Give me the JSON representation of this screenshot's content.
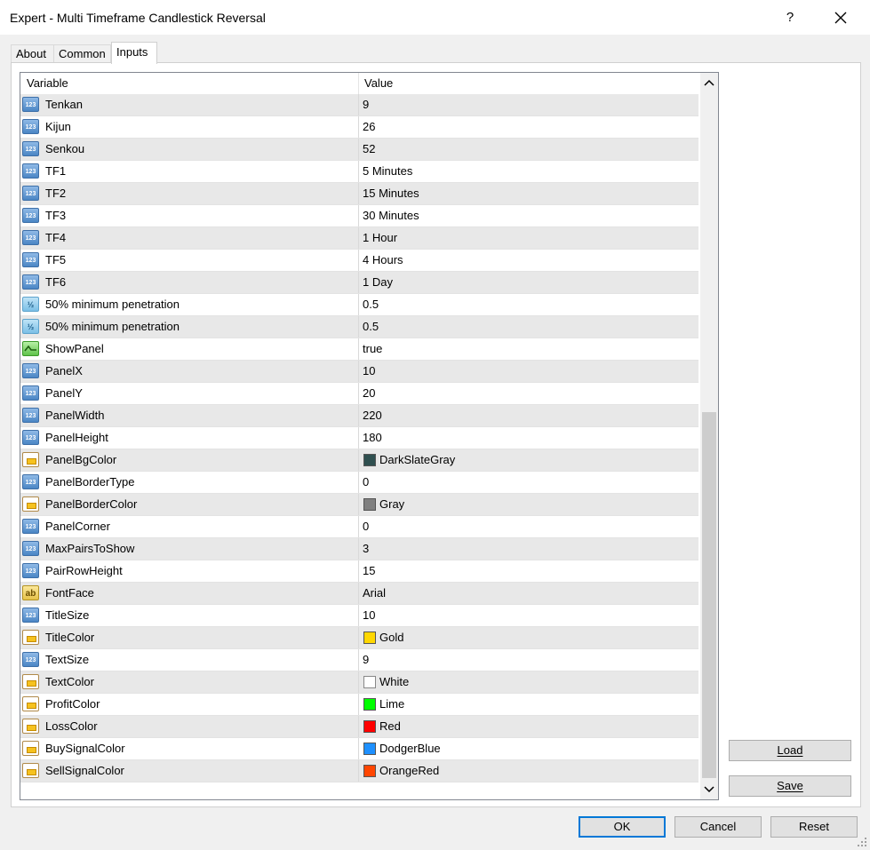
{
  "window": {
    "title": "Expert - Multi Timeframe Candlestick Reversal",
    "help_label": "?"
  },
  "tabs": [
    {
      "label": "About"
    },
    {
      "label": "Common"
    },
    {
      "label": "Inputs"
    }
  ],
  "active_tab": "Inputs",
  "grid": {
    "columns": {
      "variable": "Variable",
      "value": "Value"
    },
    "rows": [
      {
        "icon": "int",
        "name": "Tenkan",
        "value": "9"
      },
      {
        "icon": "int",
        "name": "Kijun",
        "value": "26"
      },
      {
        "icon": "int",
        "name": "Senkou",
        "value": "52"
      },
      {
        "icon": "int",
        "name": "TF1",
        "value": "5 Minutes"
      },
      {
        "icon": "int",
        "name": "TF2",
        "value": "15 Minutes"
      },
      {
        "icon": "int",
        "name": "TF3",
        "value": "30 Minutes"
      },
      {
        "icon": "int",
        "name": "TF4",
        "value": "1 Hour"
      },
      {
        "icon": "int",
        "name": "TF5",
        "value": "4 Hours"
      },
      {
        "icon": "int",
        "name": "TF6",
        "value": "1 Day"
      },
      {
        "icon": "dbl",
        "name": "50% minimum penetration",
        "value": "0.5"
      },
      {
        "icon": "dbl",
        "name": "50% minimum penetration",
        "value": "0.5"
      },
      {
        "icon": "bool",
        "name": "ShowPanel",
        "value": "true"
      },
      {
        "icon": "int",
        "name": "PanelX",
        "value": "10"
      },
      {
        "icon": "int",
        "name": "PanelY",
        "value": "20"
      },
      {
        "icon": "int",
        "name": "PanelWidth",
        "value": "220"
      },
      {
        "icon": "int",
        "name": "PanelHeight",
        "value": "180"
      },
      {
        "icon": "clr",
        "name": "PanelBgColor",
        "value": "DarkSlateGray",
        "swatch": "#2f4f4f"
      },
      {
        "icon": "int",
        "name": "PanelBorderType",
        "value": "0"
      },
      {
        "icon": "clr",
        "name": "PanelBorderColor",
        "value": "Gray",
        "swatch": "#808080"
      },
      {
        "icon": "int",
        "name": "PanelCorner",
        "value": "0"
      },
      {
        "icon": "int",
        "name": "MaxPairsToShow",
        "value": "3"
      },
      {
        "icon": "int",
        "name": "PairRowHeight",
        "value": "15"
      },
      {
        "icon": "str",
        "name": "FontFace",
        "value": "Arial"
      },
      {
        "icon": "int",
        "name": "TitleSize",
        "value": "10"
      },
      {
        "icon": "clr",
        "name": "TitleColor",
        "value": "Gold",
        "swatch": "#ffd700"
      },
      {
        "icon": "int",
        "name": "TextSize",
        "value": "9"
      },
      {
        "icon": "clr",
        "name": "TextColor",
        "value": "White",
        "swatch": "#ffffff"
      },
      {
        "icon": "clr",
        "name": "ProfitColor",
        "value": "Lime",
        "swatch": "#00ff00"
      },
      {
        "icon": "clr",
        "name": "LossColor",
        "value": "Red",
        "swatch": "#ff0000"
      },
      {
        "icon": "clr",
        "name": "BuySignalColor",
        "value": "DodgerBlue",
        "swatch": "#1e90ff"
      },
      {
        "icon": "clr",
        "name": "SellSignalColor",
        "value": "OrangeRed",
        "swatch": "#ff4500"
      }
    ]
  },
  "side_buttons": {
    "load": "Load",
    "save": "Save"
  },
  "footer_buttons": {
    "ok": "OK",
    "cancel": "Cancel",
    "reset": "Reset"
  }
}
